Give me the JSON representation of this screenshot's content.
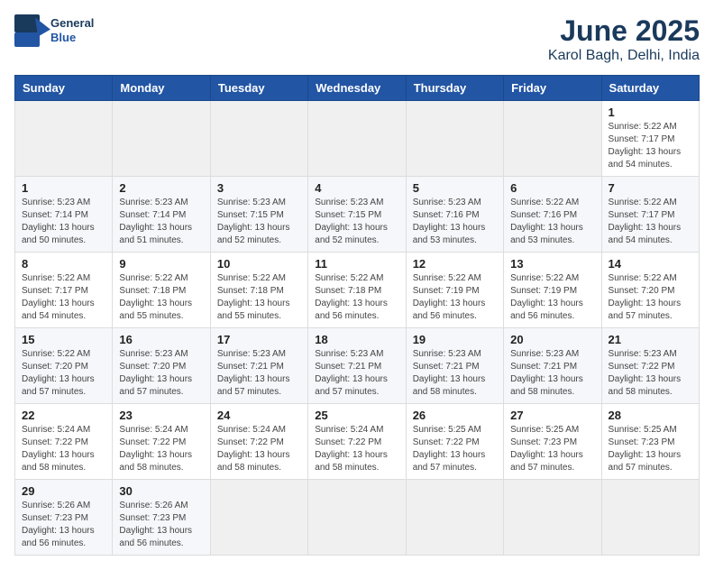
{
  "header": {
    "logo_line1": "General",
    "logo_line2": "Blue",
    "title": "June 2025",
    "subtitle": "Karol Bagh, Delhi, India"
  },
  "calendar": {
    "days_of_week": [
      "Sunday",
      "Monday",
      "Tuesday",
      "Wednesday",
      "Thursday",
      "Friday",
      "Saturday"
    ],
    "weeks": [
      [
        null,
        null,
        null,
        null,
        null,
        null,
        {
          "num": "1",
          "sunrise": "5:22 AM",
          "sunset": "7:17 PM",
          "daylight": "13 hours and 54 minutes."
        }
      ],
      [
        {
          "num": "1",
          "sunrise": "5:23 AM",
          "sunset": "7:14 PM",
          "daylight": "13 hours and 50 minutes."
        },
        {
          "num": "2",
          "sunrise": "5:23 AM",
          "sunset": "7:14 PM",
          "daylight": "13 hours and 51 minutes."
        },
        {
          "num": "3",
          "sunrise": "5:23 AM",
          "sunset": "7:15 PM",
          "daylight": "13 hours and 52 minutes."
        },
        {
          "num": "4",
          "sunrise": "5:23 AM",
          "sunset": "7:15 PM",
          "daylight": "13 hours and 52 minutes."
        },
        {
          "num": "5",
          "sunrise": "5:23 AM",
          "sunset": "7:16 PM",
          "daylight": "13 hours and 53 minutes."
        },
        {
          "num": "6",
          "sunrise": "5:22 AM",
          "sunset": "7:16 PM",
          "daylight": "13 hours and 53 minutes."
        },
        {
          "num": "7",
          "sunrise": "5:22 AM",
          "sunset": "7:17 PM",
          "daylight": "13 hours and 54 minutes."
        }
      ],
      [
        {
          "num": "8",
          "sunrise": "5:22 AM",
          "sunset": "7:17 PM",
          "daylight": "13 hours and 54 minutes."
        },
        {
          "num": "9",
          "sunrise": "5:22 AM",
          "sunset": "7:18 PM",
          "daylight": "13 hours and 55 minutes."
        },
        {
          "num": "10",
          "sunrise": "5:22 AM",
          "sunset": "7:18 PM",
          "daylight": "13 hours and 55 minutes."
        },
        {
          "num": "11",
          "sunrise": "5:22 AM",
          "sunset": "7:18 PM",
          "daylight": "13 hours and 56 minutes."
        },
        {
          "num": "12",
          "sunrise": "5:22 AM",
          "sunset": "7:19 PM",
          "daylight": "13 hours and 56 minutes."
        },
        {
          "num": "13",
          "sunrise": "5:22 AM",
          "sunset": "7:19 PM",
          "daylight": "13 hours and 56 minutes."
        },
        {
          "num": "14",
          "sunrise": "5:22 AM",
          "sunset": "7:20 PM",
          "daylight": "13 hours and 57 minutes."
        }
      ],
      [
        {
          "num": "15",
          "sunrise": "5:22 AM",
          "sunset": "7:20 PM",
          "daylight": "13 hours and 57 minutes."
        },
        {
          "num": "16",
          "sunrise": "5:23 AM",
          "sunset": "7:20 PM",
          "daylight": "13 hours and 57 minutes."
        },
        {
          "num": "17",
          "sunrise": "5:23 AM",
          "sunset": "7:21 PM",
          "daylight": "13 hours and 57 minutes."
        },
        {
          "num": "18",
          "sunrise": "5:23 AM",
          "sunset": "7:21 PM",
          "daylight": "13 hours and 57 minutes."
        },
        {
          "num": "19",
          "sunrise": "5:23 AM",
          "sunset": "7:21 PM",
          "daylight": "13 hours and 58 minutes."
        },
        {
          "num": "20",
          "sunrise": "5:23 AM",
          "sunset": "7:21 PM",
          "daylight": "13 hours and 58 minutes."
        },
        {
          "num": "21",
          "sunrise": "5:23 AM",
          "sunset": "7:22 PM",
          "daylight": "13 hours and 58 minutes."
        }
      ],
      [
        {
          "num": "22",
          "sunrise": "5:24 AM",
          "sunset": "7:22 PM",
          "daylight": "13 hours and 58 minutes."
        },
        {
          "num": "23",
          "sunrise": "5:24 AM",
          "sunset": "7:22 PM",
          "daylight": "13 hours and 58 minutes."
        },
        {
          "num": "24",
          "sunrise": "5:24 AM",
          "sunset": "7:22 PM",
          "daylight": "13 hours and 58 minutes."
        },
        {
          "num": "25",
          "sunrise": "5:24 AM",
          "sunset": "7:22 PM",
          "daylight": "13 hours and 58 minutes."
        },
        {
          "num": "26",
          "sunrise": "5:25 AM",
          "sunset": "7:22 PM",
          "daylight": "13 hours and 57 minutes."
        },
        {
          "num": "27",
          "sunrise": "5:25 AM",
          "sunset": "7:23 PM",
          "daylight": "13 hours and 57 minutes."
        },
        {
          "num": "28",
          "sunrise": "5:25 AM",
          "sunset": "7:23 PM",
          "daylight": "13 hours and 57 minutes."
        }
      ],
      [
        {
          "num": "29",
          "sunrise": "5:26 AM",
          "sunset": "7:23 PM",
          "daylight": "13 hours and 56 minutes."
        },
        {
          "num": "30",
          "sunrise": "5:26 AM",
          "sunset": "7:23 PM",
          "daylight": "13 hours and 56 minutes."
        },
        null,
        null,
        null,
        null,
        null
      ]
    ]
  }
}
